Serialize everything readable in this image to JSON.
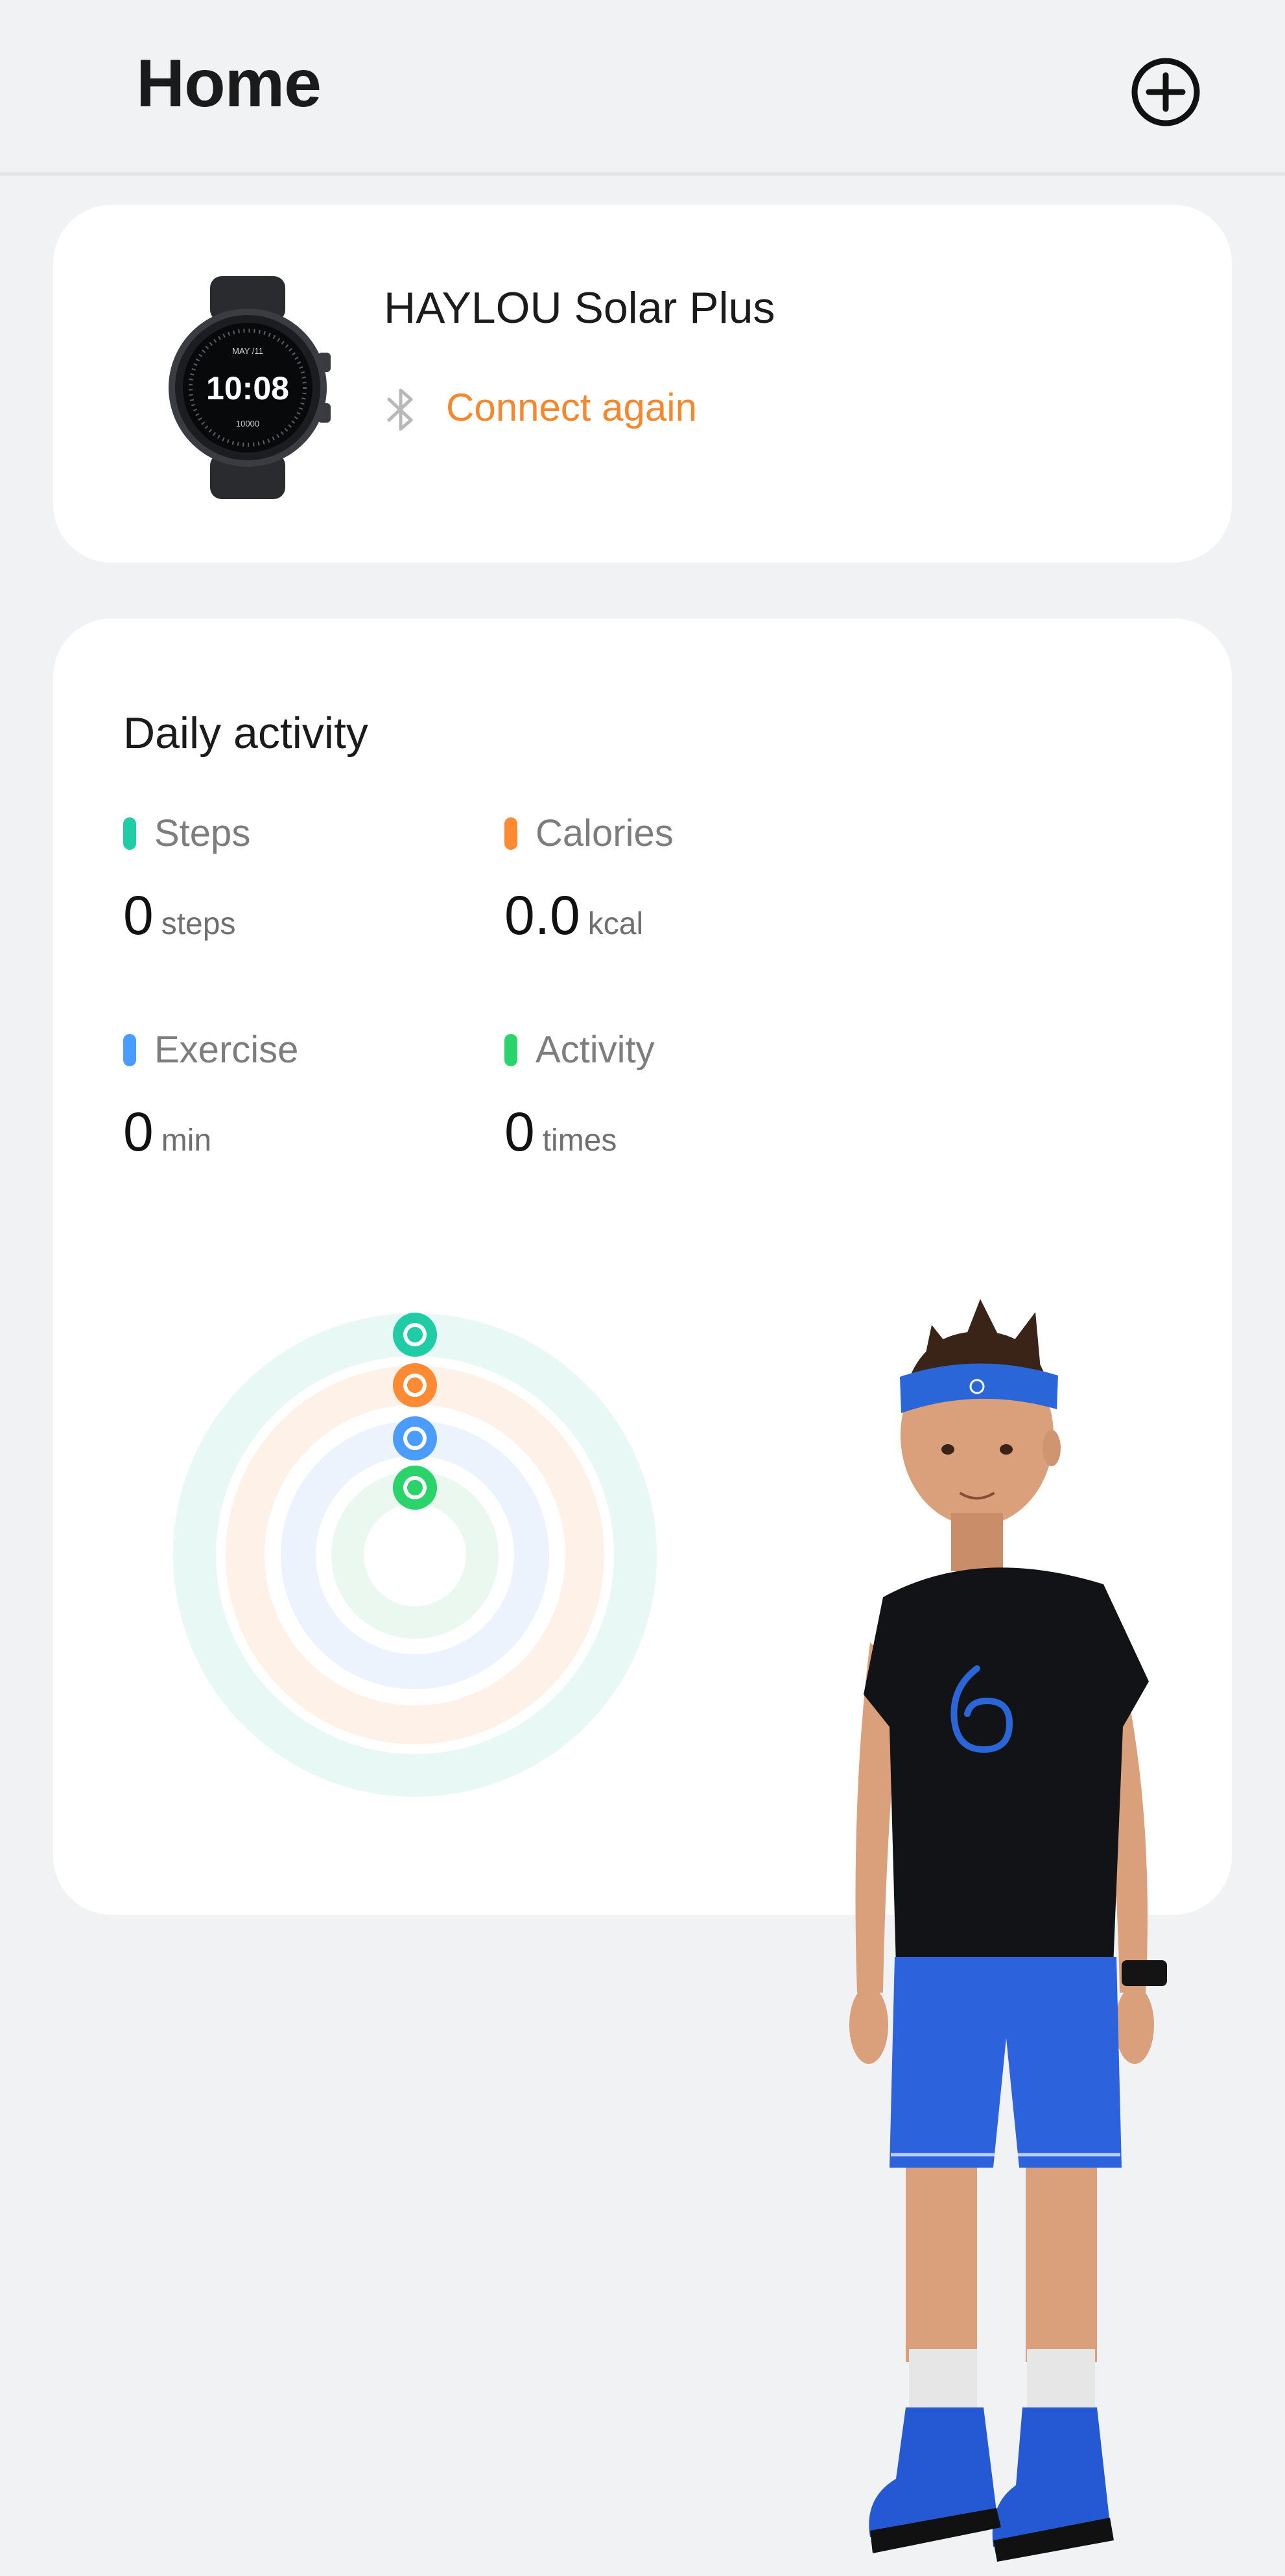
{
  "header": {
    "title": "Home"
  },
  "device": {
    "name": "HAYLOU Solar Plus",
    "status": "Connect again",
    "watch_face": {
      "date": "MAY /11",
      "time": "10:08",
      "steps": "10000"
    }
  },
  "activity": {
    "title": "Daily activity",
    "metrics": [
      {
        "label": "Steps",
        "value": "0",
        "unit": "steps",
        "color": "#1fcca6"
      },
      {
        "label": "Calories",
        "value": "0.0",
        "unit": "kcal",
        "color": "#ff8a34"
      },
      {
        "label": "Exercise",
        "value": "0",
        "unit": "min",
        "color": "#4b9cff"
      },
      {
        "label": "Activity",
        "value": "0",
        "unit": "times",
        "color": "#2bd36b"
      }
    ],
    "rings": [
      {
        "metric": "Steps",
        "progress": 0,
        "color": "#1fcca6",
        "track": "#e8f8f4",
        "icon": "shoe-icon"
      },
      {
        "metric": "Calories",
        "progress": 0,
        "color": "#ff8a34",
        "track": "#fdf1e8",
        "icon": "flame-icon"
      },
      {
        "metric": "Exercise",
        "progress": 0,
        "color": "#4b9cff",
        "track": "#edf3fd",
        "icon": "clock-icon"
      },
      {
        "metric": "Activity",
        "progress": 0,
        "color": "#2bd36b",
        "track": "#eaf8ef",
        "icon": "activity-icon"
      }
    ]
  },
  "colors": {
    "accent_orange": "#f5872d",
    "background": "#f1f2f4",
    "card": "#ffffff"
  }
}
